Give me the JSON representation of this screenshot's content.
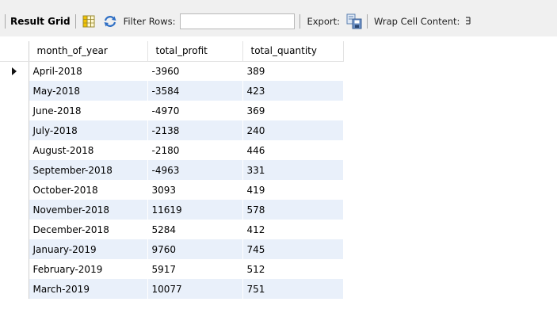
{
  "toolbar": {
    "title": "Result Grid",
    "filter_label": "Filter Rows:",
    "filter_value": "",
    "export_label": "Export:",
    "wrap_label": "Wrap Cell Content:",
    "icons": [
      "grid-icon",
      "refresh-icon",
      "export-icon",
      "wrap-icon"
    ]
  },
  "grid": {
    "columns": [
      "month_of_year",
      "total_profit",
      "total_quantity"
    ],
    "current_row": 0,
    "rows": [
      [
        "April-2018",
        "-3960",
        "389"
      ],
      [
        "May-2018",
        "-3584",
        "423"
      ],
      [
        "June-2018",
        "-4970",
        "369"
      ],
      [
        "July-2018",
        "-2138",
        "240"
      ],
      [
        "August-2018",
        "-2180",
        "446"
      ],
      [
        "September-2018",
        "-4963",
        "331"
      ],
      [
        "October-2018",
        "3093",
        "419"
      ],
      [
        "November-2018",
        "11619",
        "578"
      ],
      [
        "December-2018",
        "5284",
        "412"
      ],
      [
        "January-2019",
        "9760",
        "745"
      ],
      [
        "February-2019",
        "5917",
        "512"
      ],
      [
        "March-2019",
        "10077",
        "751"
      ]
    ],
    "colors": {
      "stripe": "#e9f0fa",
      "header_bg": "#ffffff",
      "toolbar_bg": "#f0f0f0"
    }
  }
}
